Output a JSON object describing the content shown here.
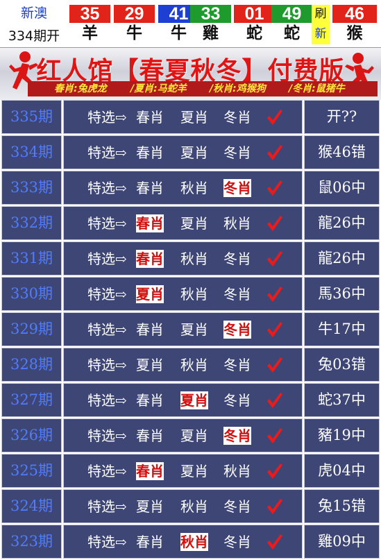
{
  "header": {
    "region": "新澳",
    "issue_label": "334期开",
    "balls": [
      {
        "num": "35",
        "zodiac": "羊",
        "color": "#e2231a"
      },
      {
        "num": "29",
        "zodiac": "牛",
        "color": "#e2231a"
      },
      {
        "num": "41",
        "zodiac": "牛",
        "color": "#1d3fd2"
      },
      {
        "num": "33",
        "zodiac": "雞",
        "color": "#1f9a2c"
      },
      {
        "num": "01",
        "zodiac": "蛇",
        "color": "#e2231a"
      },
      {
        "num": "49",
        "zodiac": "蛇",
        "color": "#1f9a2c"
      }
    ],
    "refresh_top": "刷",
    "refresh_bottom": "新",
    "special_ball": {
      "num": "46",
      "zodiac": "猴",
      "color": "#e2231a"
    }
  },
  "banner": {
    "title": "红人馆【春夏秋冬】付费版",
    "spring": "春肖:兔虎龙",
    "summer": "/夏肖:马蛇羊",
    "autumn": "/秋肖:鸡猴狗",
    "winter": "/冬肖:鼠猪牛"
  },
  "rows": [
    {
      "issue": "335期",
      "prefix": "特选⇨",
      "picks": [
        "春肖",
        "夏肖",
        "冬肖"
      ],
      "hit": -1,
      "result": "开??"
    },
    {
      "issue": "334期",
      "prefix": "特选⇨",
      "picks": [
        "春肖",
        "夏肖",
        "冬肖"
      ],
      "hit": -1,
      "result": "猴46错"
    },
    {
      "issue": "333期",
      "prefix": "特选⇨",
      "picks": [
        "春肖",
        "秋肖",
        "冬肖"
      ],
      "hit": 2,
      "result": "鼠06中"
    },
    {
      "issue": "332期",
      "prefix": "特选⇨",
      "picks": [
        "春肖",
        "夏肖",
        "秋肖"
      ],
      "hit": 0,
      "result": "龍26中"
    },
    {
      "issue": "331期",
      "prefix": "特选⇨",
      "picks": [
        "春肖",
        "秋肖",
        "冬肖"
      ],
      "hit": 0,
      "result": "龍26中"
    },
    {
      "issue": "330期",
      "prefix": "特选⇨",
      "picks": [
        "夏肖",
        "秋肖",
        "冬肖"
      ],
      "hit": 0,
      "result": "馬36中"
    },
    {
      "issue": "329期",
      "prefix": "特选⇨",
      "picks": [
        "春肖",
        "夏肖",
        "冬肖"
      ],
      "hit": 2,
      "result": "牛17中"
    },
    {
      "issue": "328期",
      "prefix": "特选⇨",
      "picks": [
        "夏肖",
        "秋肖",
        "冬肖"
      ],
      "hit": -1,
      "result": "兔03错"
    },
    {
      "issue": "327期",
      "prefix": "特选⇨",
      "picks": [
        "春肖",
        "夏肖",
        "冬肖"
      ],
      "hit": 1,
      "result": "蛇37中"
    },
    {
      "issue": "326期",
      "prefix": "特选⇨",
      "picks": [
        "春肖",
        "夏肖",
        "冬肖"
      ],
      "hit": 2,
      "result": "豬19中"
    },
    {
      "issue": "325期",
      "prefix": "特选⇨",
      "picks": [
        "春肖",
        "夏肖",
        "秋肖"
      ],
      "hit": 0,
      "result": "虎04中"
    },
    {
      "issue": "324期",
      "prefix": "特选⇨",
      "picks": [
        "夏肖",
        "秋肖",
        "冬肖"
      ],
      "hit": -1,
      "result": "兔15错"
    },
    {
      "issue": "323期",
      "prefix": "特选⇨",
      "picks": [
        "春肖",
        "秋肖",
        "冬肖"
      ],
      "hit": 1,
      "result": "雞09中"
    }
  ],
  "icons": {
    "check": "check-mark-icon",
    "runner": "running-man-icon"
  },
  "colors": {
    "row_bg": "#3e4675",
    "issue_text": "#4f7cff",
    "hit_text": "#d11010",
    "banner_title": "#e11414"
  }
}
